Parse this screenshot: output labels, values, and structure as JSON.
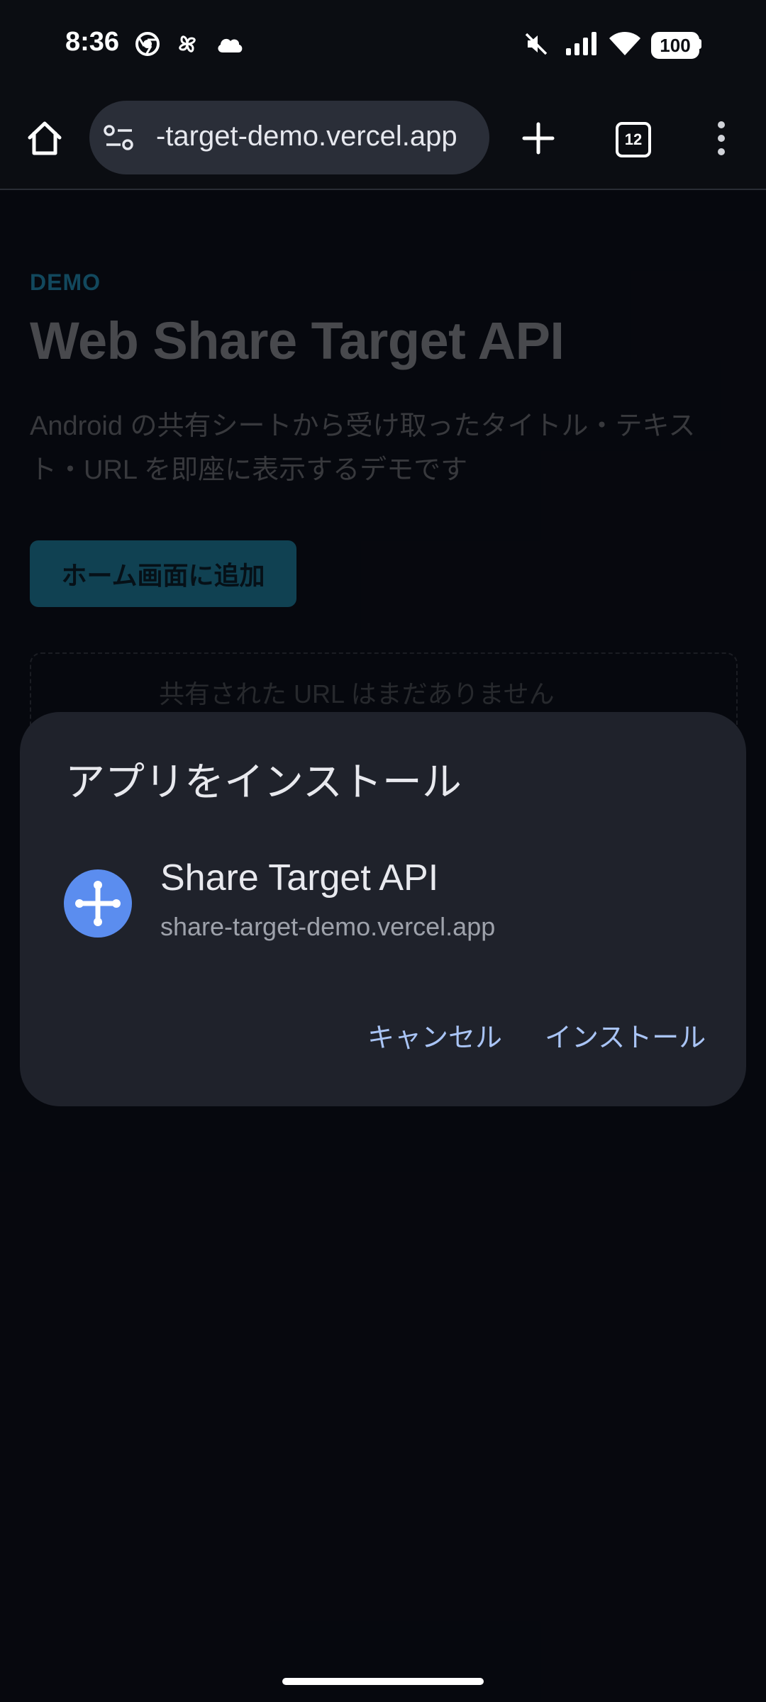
{
  "status_bar": {
    "time": "8:36",
    "battery": "100",
    "left_icons": [
      "chrome-icon",
      "pinwheel-icon",
      "cloud-icon"
    ],
    "right_icons": [
      "mute-icon",
      "signal-icon",
      "wifi-icon",
      "battery-icon"
    ]
  },
  "browser": {
    "url": "-target-demo.vercel.app",
    "tab_count": "12",
    "icons": [
      "home-icon",
      "site-settings-icon",
      "new-tab-icon",
      "tab-switcher-icon",
      "more-menu-icon"
    ]
  },
  "page": {
    "eyebrow": "DEMO",
    "heading": "Web Share Target API",
    "description": "Android の共有シートから受け取ったタイトル・テキスト・URL を即座に表示するデモです",
    "add_home_button": "ホーム画面に追加",
    "share_empty": "共有された URL はまだありません"
  },
  "dialog": {
    "title": "アプリをインストール",
    "app_name": "Share Target API",
    "app_url": "share-target-demo.vercel.app",
    "cancel": "キャンセル",
    "install": "インストール"
  },
  "colors": {
    "accent": "#a9c4f5",
    "app_icon_bg": "#5b8def",
    "dialog_bg": "#1f222b",
    "page_button": "#19647f",
    "eyebrow": "#1d6f8f"
  }
}
